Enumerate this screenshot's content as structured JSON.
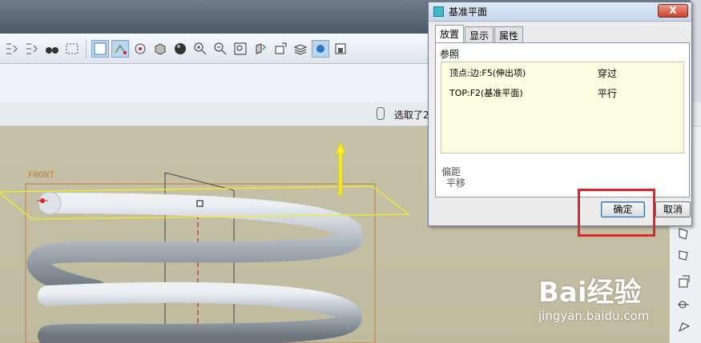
{
  "window": {
    "right_edge_color": "#d7dbe1"
  },
  "toolbar": {
    "icons": [
      "regen-left-icon",
      "regen-right-icon",
      "binoculars-icon",
      "select-box-icon",
      "sketch-view-icon",
      "datum-axis-icon",
      "layer-tree-icon",
      "shade-icon",
      "sphere-icon",
      "zoom-in-icon",
      "zoom-out-icon",
      "refit-icon",
      "orient-icon",
      "annotation-icon",
      "layers-icon",
      "display-style-icon",
      "saved-view-icon"
    ]
  },
  "status": {
    "message": "选取了2"
  },
  "dialog": {
    "title": "基准平面",
    "close_label": "X",
    "tabs": [
      {
        "label": "放置",
        "active": true
      },
      {
        "label": "显示",
        "active": false
      },
      {
        "label": "属性",
        "active": false
      }
    ],
    "references_header": "参照",
    "references": [
      {
        "ref": "顶点:边:F5(伸出项)",
        "constraint": "穿过"
      },
      {
        "ref": "TOP:F2(基准平面)",
        "constraint": "平行"
      }
    ],
    "offset_label": "偏距",
    "offset_value": "平移",
    "ok_label": "确定",
    "cancel_label": "取消"
  },
  "viewport": {
    "plane_label": "FRONT"
  },
  "watermark": {
    "brand": "Bai经验",
    "url": "jingyan.baidu.com"
  },
  "colors": {
    "accent_red": "#e0262a",
    "datum_yellow": "#f2ee2a",
    "reference_bg": "#fdfde1"
  }
}
